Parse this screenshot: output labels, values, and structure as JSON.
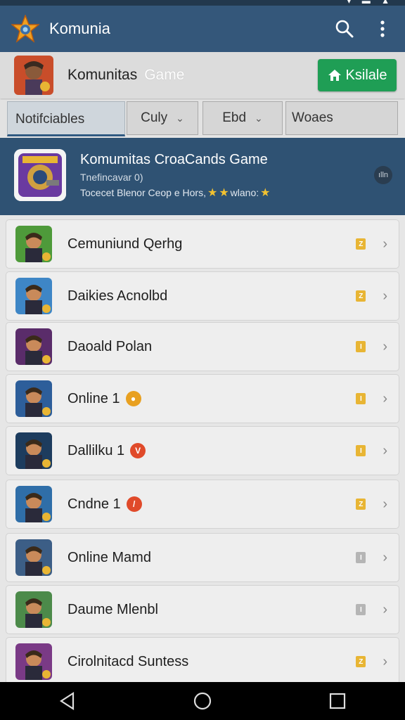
{
  "app_bar": {
    "title": "Komunia",
    "icons": {
      "logo": "star-logo-icon",
      "search": "search-icon",
      "more": "more-vert-icon"
    }
  },
  "game_header": {
    "title": "Komunitas",
    "title_light": "Game",
    "install_label": "Ksilale",
    "install_icon": "home-icon"
  },
  "filters": {
    "tab_label": "Notifciables",
    "dropdowns": [
      {
        "label": "Culy"
      },
      {
        "label": "Ebd"
      },
      {
        "label": "Woaes"
      }
    ]
  },
  "featured": {
    "title": "Komumitas CroaCands Game",
    "subtitle": "Tnefincavar 0)",
    "line3_prefix": "Tocecet Blenor Ceop e Hors,",
    "line3_suffix": "wlano:",
    "more_label": "ılln",
    "accent": "#f2c230"
  },
  "items": [
    {
      "name": "Cemuniund Qerhg",
      "badge": "",
      "tag_color": "#e8b534",
      "tag_text": "Z",
      "icon_bg": "#4e9a3a"
    },
    {
      "name": "Daikies Acnolbd",
      "badge": "",
      "tag_color": "#e8b534",
      "tag_text": "Z",
      "icon_bg": "#3e86c6"
    },
    {
      "name": "Daoald Polan",
      "badge": "",
      "tag_color": "#e8b534",
      "tag_text": "I",
      "icon_bg": "#5a2c6a"
    },
    {
      "name": "Online 1",
      "badge": "●",
      "badge_color": "#e8a020",
      "tag_color": "#e8b534",
      "tag_text": "I",
      "icon_bg": "#2d5e9a"
    },
    {
      "name": "Dallilku 1",
      "badge": "V",
      "badge_color": "#e04a2a",
      "tag_color": "#e8b534",
      "tag_text": "I",
      "icon_bg": "#1d3c5e"
    },
    {
      "name": "Cndne 1",
      "badge": "/",
      "badge_color": "#e04a2a",
      "tag_color": "#e8b534",
      "tag_text": "Z",
      "icon_bg": "#2f6ea8"
    },
    {
      "name": "Online Mamd",
      "badge": "",
      "tag_color": "#b5b5b5",
      "tag_text": "I",
      "icon_bg": "#3c5e86"
    },
    {
      "name": "Daume Mlenbl",
      "badge": "",
      "tag_color": "#b5b5b5",
      "tag_text": "I",
      "icon_bg": "#4c8a4a"
    },
    {
      "name": "Cirolnitacd Suntess",
      "badge": "",
      "tag_color": "#e8b534",
      "tag_text": "Z",
      "icon_bg": "#7a3a86"
    }
  ],
  "nav": {
    "back": "back-icon",
    "home": "home-circle-icon",
    "recents": "recents-icon"
  }
}
